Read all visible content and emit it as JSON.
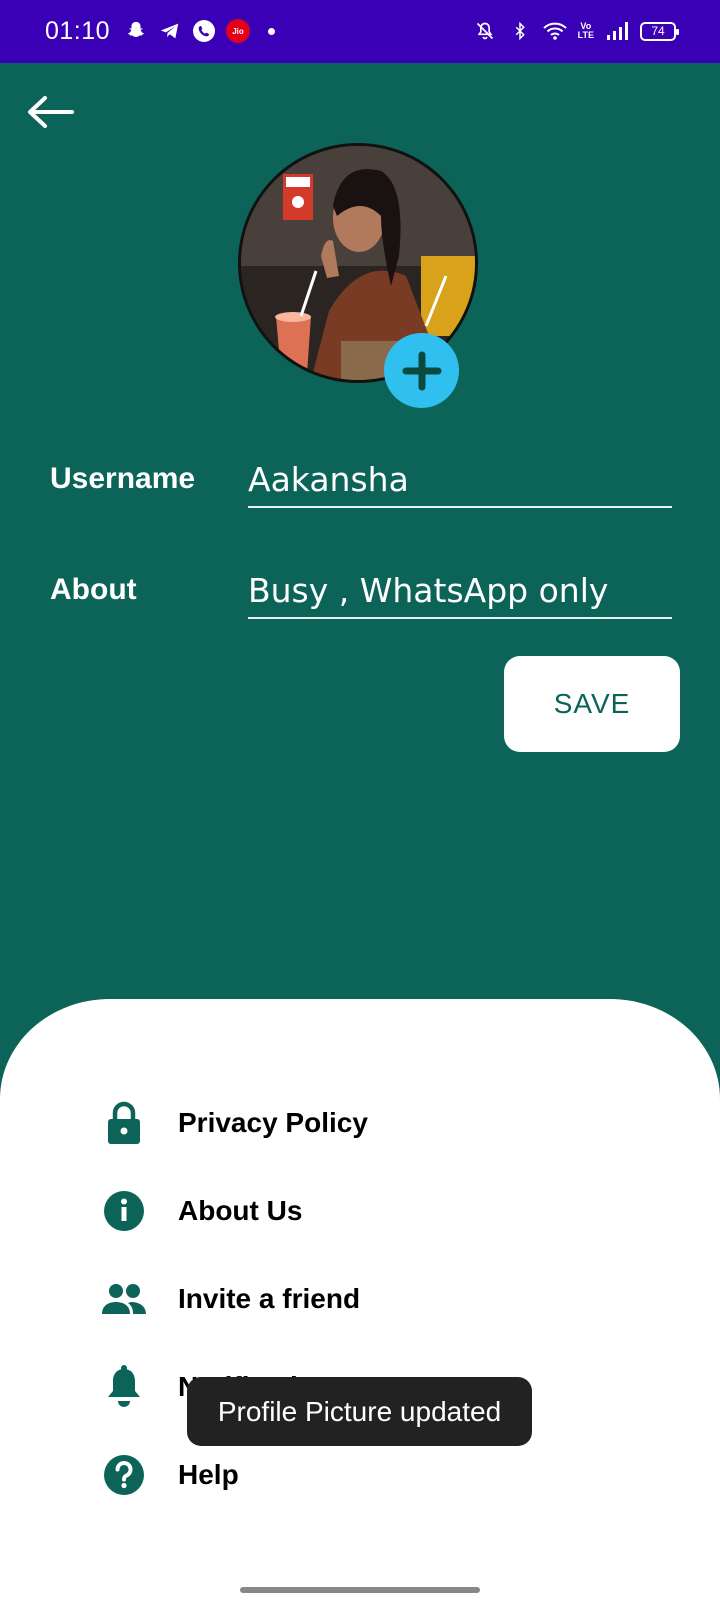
{
  "status_bar": {
    "time": "01:10",
    "jio_label": "Jio",
    "volte_top": "Vo",
    "volte_bottom": "LTE",
    "battery": "74",
    "background": "#3a00b5",
    "left_icons": [
      "snapchat-icon",
      "telegram-icon",
      "whatsapp-icon",
      "jio-icon",
      "notification-dot-icon"
    ],
    "right_icons": [
      "notifications-off-icon",
      "bluetooth-icon",
      "wifi-icon",
      "volte-icon",
      "signal-icon",
      "battery-icon"
    ]
  },
  "header": {
    "back_icon": "arrow-left-icon"
  },
  "profile": {
    "add_photo_icon": "plus-icon",
    "username_label": "Username",
    "username_value": "Aakansha",
    "about_label": "About",
    "about_value": "Busy , WhatsApp only",
    "save_label": "SAVE"
  },
  "menu": {
    "items": [
      {
        "label": "Privacy Policy",
        "icon": "lock-icon"
      },
      {
        "label": "About Us",
        "icon": "info-icon"
      },
      {
        "label": "Invite a friend",
        "icon": "people-icon"
      },
      {
        "label": "Notifications",
        "icon": "bell-icon"
      },
      {
        "label": "Help",
        "icon": "help-icon"
      }
    ]
  },
  "toast": {
    "message": "Profile Picture updated"
  },
  "colors": {
    "primary": "#0c6357",
    "accent": "#2fc0f0",
    "surface": "#ffffff"
  }
}
